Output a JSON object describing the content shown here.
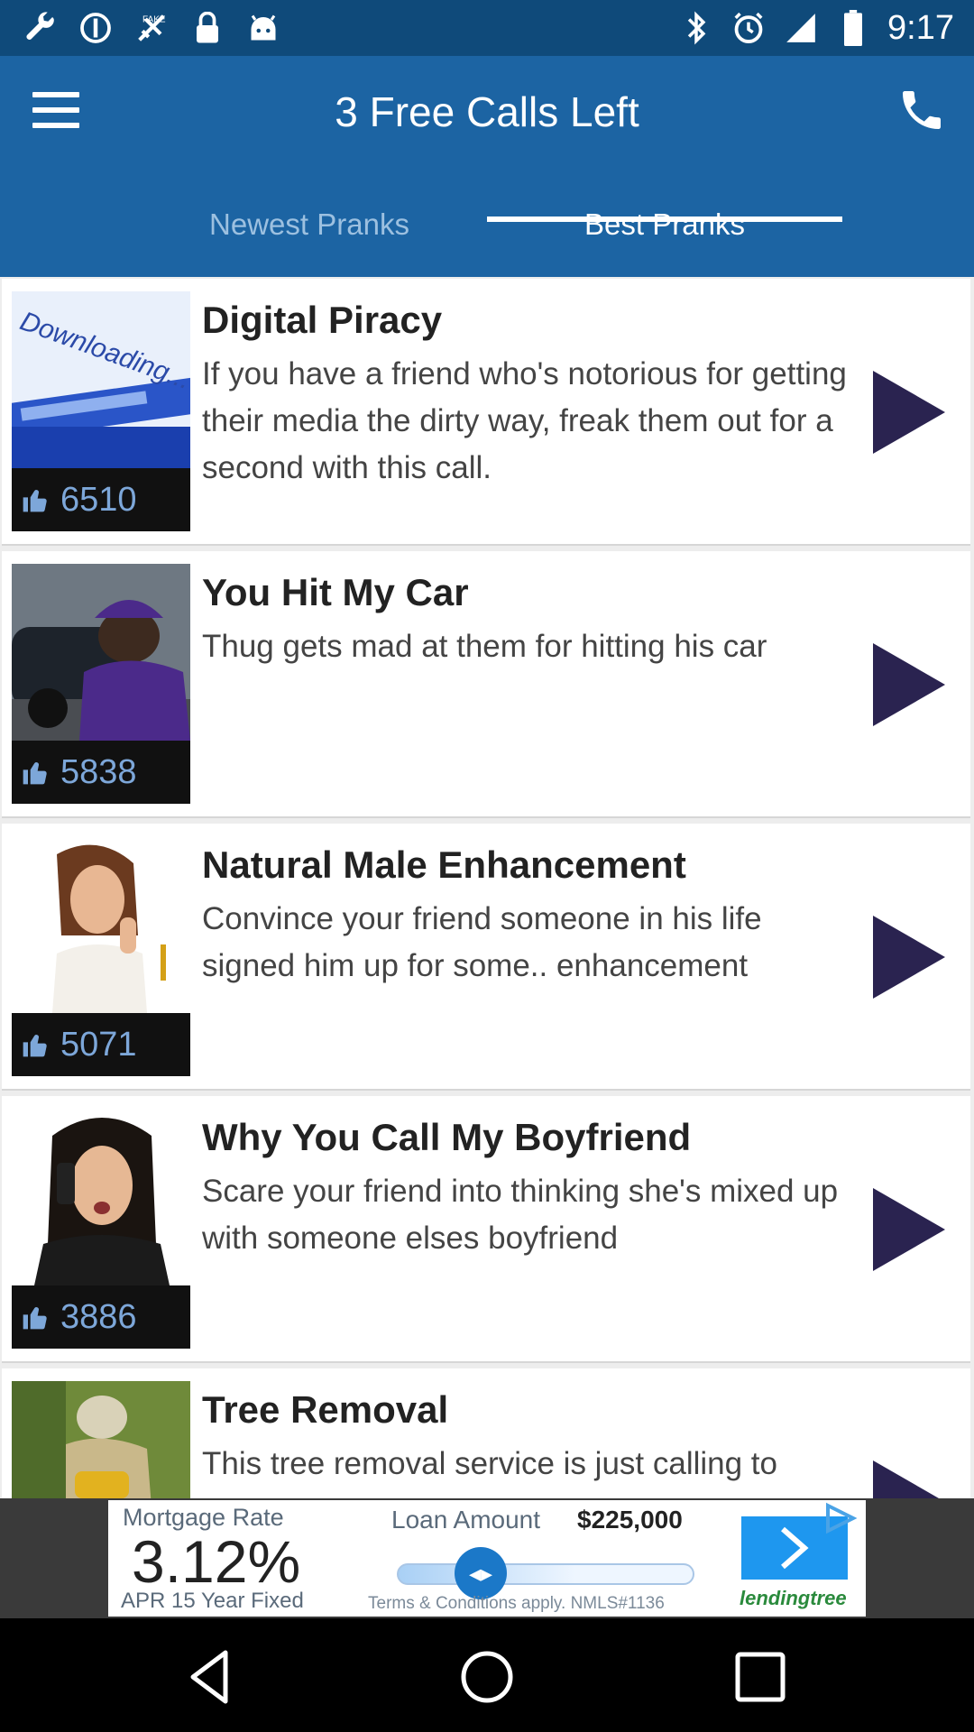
{
  "status_bar": {
    "time": "9:17",
    "left_icons": [
      "wrench-icon",
      "no-sim-icon",
      "fake-gps-icon",
      "lock-icon",
      "android-icon"
    ],
    "right_icons": [
      "bluetooth-icon",
      "alarm-icon",
      "signal-icon",
      "battery-icon"
    ]
  },
  "header": {
    "title": "3 Free Calls Left",
    "menu_icon": "menu-icon",
    "call_icon": "phone-icon"
  },
  "tabs": [
    {
      "label": "Newest Pranks",
      "selected": false
    },
    {
      "label": "Best Pranks",
      "selected": true
    }
  ],
  "pranks": [
    {
      "title": "Digital Piracy",
      "description": "If you have a friend who's notorious for getting their media the dirty way, freak them out for a second with this call.",
      "likes": "6510"
    },
    {
      "title": "You Hit My Car",
      "description": "Thug gets mad at them for hitting his car",
      "likes": "5838"
    },
    {
      "title": "Natural Male Enhancement",
      "description": "Convince your friend someone in his life signed him up for some.. enhancement",
      "likes": "5071"
    },
    {
      "title": "Why You Call My Boyfriend",
      "description": "Scare your friend into thinking she's mixed up with someone elses boyfriend",
      "likes": "3886"
    },
    {
      "title": "Tree Removal",
      "description": "This tree removal service is just calling to",
      "likes": ""
    }
  ],
  "ad": {
    "label": "Mortgage Rate",
    "rate": "3.12%",
    "apr": "APR 15 Year Fixed",
    "loan_label": "Loan Amount",
    "loan_amount": "$225,000",
    "terms": "Terms & Conditions apply. NMLS#1136",
    "brand": "lendingtree"
  },
  "colors": {
    "header": "#1c64a3",
    "status": "#0f4a7a",
    "likes_text": "#7da7d9",
    "play": "#2a2350"
  }
}
